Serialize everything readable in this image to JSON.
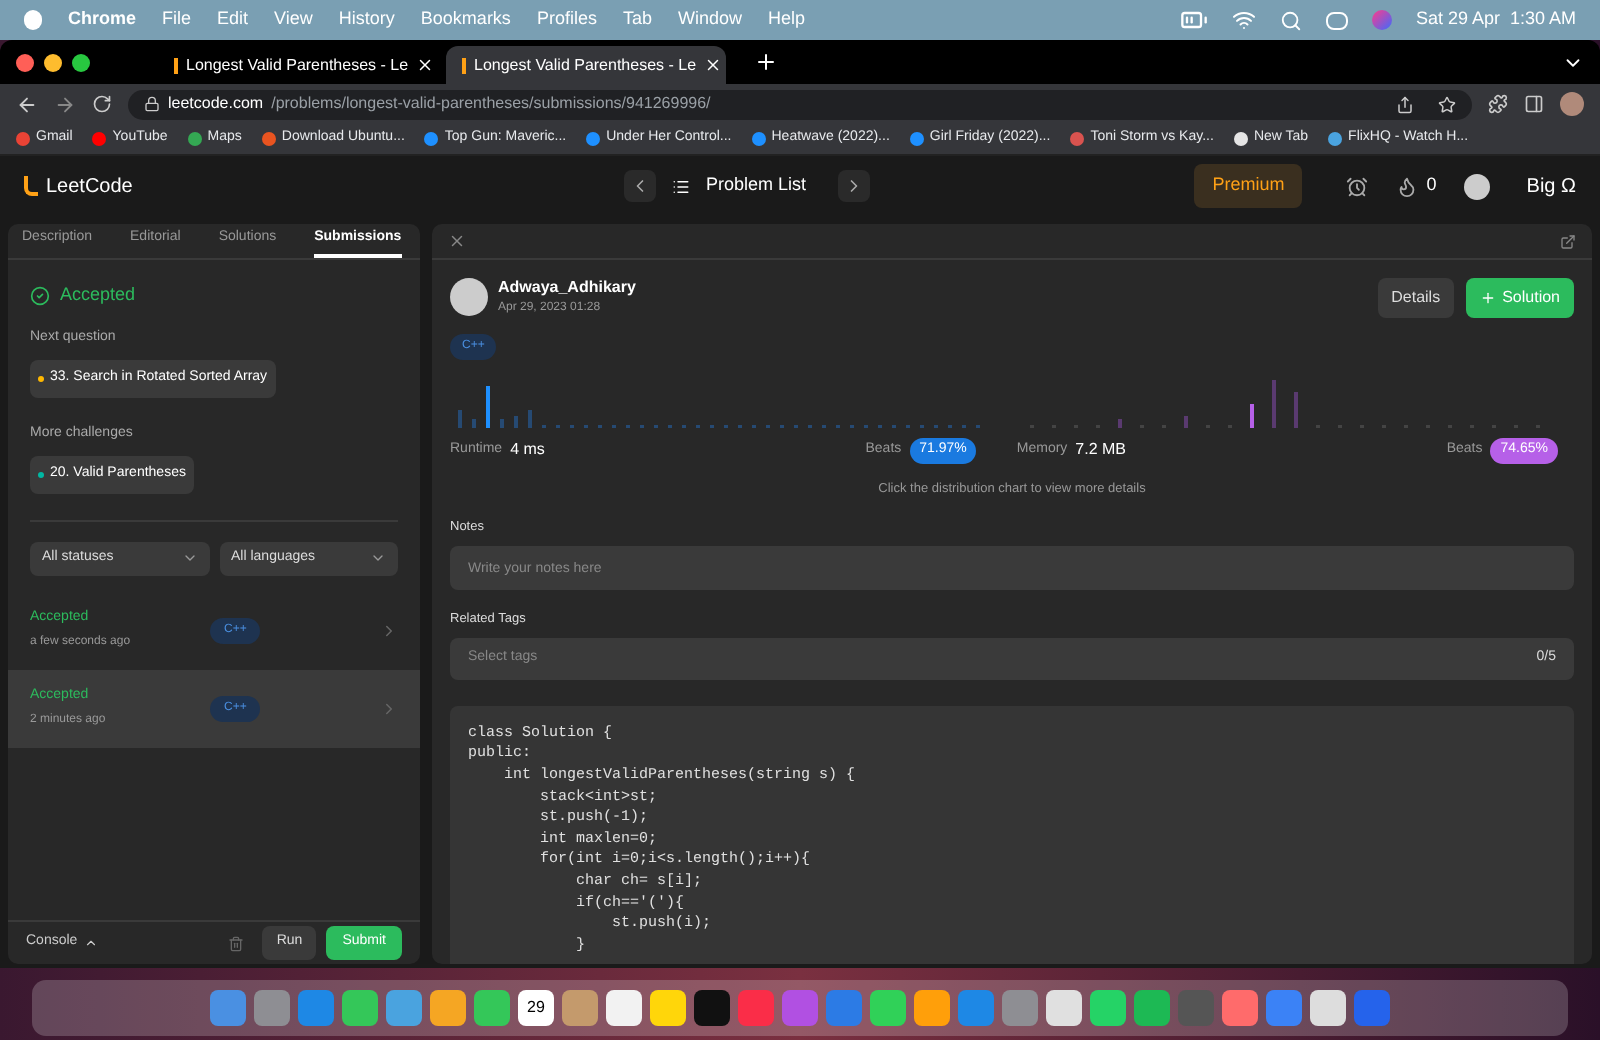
{
  "menu_bar": {
    "app": "Chrome",
    "items": [
      "File",
      "Edit",
      "View",
      "History",
      "Bookmarks",
      "Profiles",
      "Tab",
      "Window",
      "Help"
    ],
    "clock": "Sat 29 Apr  1:30 AM"
  },
  "browser_tabs": [
    {
      "title": "Longest Valid Parentheses - Le",
      "selected": false
    },
    {
      "title": "Longest Valid Parentheses - Le",
      "selected": true
    }
  ],
  "address_bar": {
    "domain": "leetcode.com",
    "path": "/problems/longest-valid-parentheses/submissions/941269996/"
  },
  "bookmarks": [
    {
      "label": "Gmail",
      "color": "#ea4335"
    },
    {
      "label": "YouTube",
      "color": "#ff0000"
    },
    {
      "label": "Maps",
      "color": "#34a853"
    },
    {
      "label": "Download Ubuntu...",
      "color": "#e95420"
    },
    {
      "label": "Top Gun: Maveric...",
      "color": "#1e90ff"
    },
    {
      "label": "Under Her Control...",
      "color": "#1e90ff"
    },
    {
      "label": "Heatwave (2022)...",
      "color": "#1e90ff"
    },
    {
      "label": "Girl Friday (2022)...",
      "color": "#1e90ff"
    },
    {
      "label": "Toni Storm vs Kay...",
      "color": "#d9534f"
    },
    {
      "label": "New Tab",
      "color": "#e5e5e5"
    },
    {
      "label": "FlixHQ - Watch H...",
      "color": "#4aa3df"
    }
  ],
  "site_nav": {
    "logo": "LeetCode",
    "problem_list": "Problem List",
    "premium": "Premium",
    "streak": "0",
    "user": "Big Ω"
  },
  "left_panel": {
    "tabs": [
      {
        "label": "Description",
        "selected": false
      },
      {
        "label": "Editorial",
        "selected": false
      },
      {
        "label": "Solutions",
        "selected": false
      },
      {
        "label": "Submissions",
        "selected": true
      }
    ],
    "status": "Accepted",
    "next_label": "Next question",
    "next_question": {
      "title": "33. Search in Rotated Sorted Array",
      "color": "#ffb800"
    },
    "more_label": "More challenges",
    "challenges": [
      {
        "title": "20. Valid Parentheses",
        "color": "#00b8a3"
      }
    ],
    "filters": [
      "All statuses",
      "All languages"
    ],
    "submissions": [
      {
        "status": "Accepted",
        "time": "a few seconds ago",
        "language": "C++",
        "selected": false
      },
      {
        "status": "Accepted",
        "time": "2 minutes ago",
        "language": "C++",
        "selected": true
      }
    ],
    "console": "Console",
    "run": "Run",
    "submit": "Submit"
  },
  "submission": {
    "user": "Adwaya_Adhikary",
    "date": "Apr 29, 2023 01:28",
    "details": "Details",
    "solution": "Solution",
    "language": "C++",
    "runtime": {
      "label": "Runtime",
      "value": "4 ms",
      "beats_label": "Beats",
      "beats": "71.97%"
    },
    "memory": {
      "label": "Memory",
      "value": "7.2 MB",
      "beats_label": "Beats",
      "beats": "74.65%"
    },
    "chart_hint": "Click the distribution chart to view more details",
    "notes_label": "Notes",
    "notes_placeholder": "Write your notes here",
    "tags_label": "Related Tags",
    "tags_placeholder": "Select tags",
    "tags_count": "0/5",
    "code": [
      "class Solution {",
      "public:",
      "    int longestValidParentheses(string s) {",
      "        stack<int>st;",
      "        st.push(-1);",
      "        int maxlen=0;",
      "        for(int i=0;i<s.length();i++){",
      "            char ch= s[i];",
      "            if(ch=='('){",
      "                st.push(i);",
      "            }"
    ]
  },
  "dock": {
    "calendar_day": "29"
  }
}
